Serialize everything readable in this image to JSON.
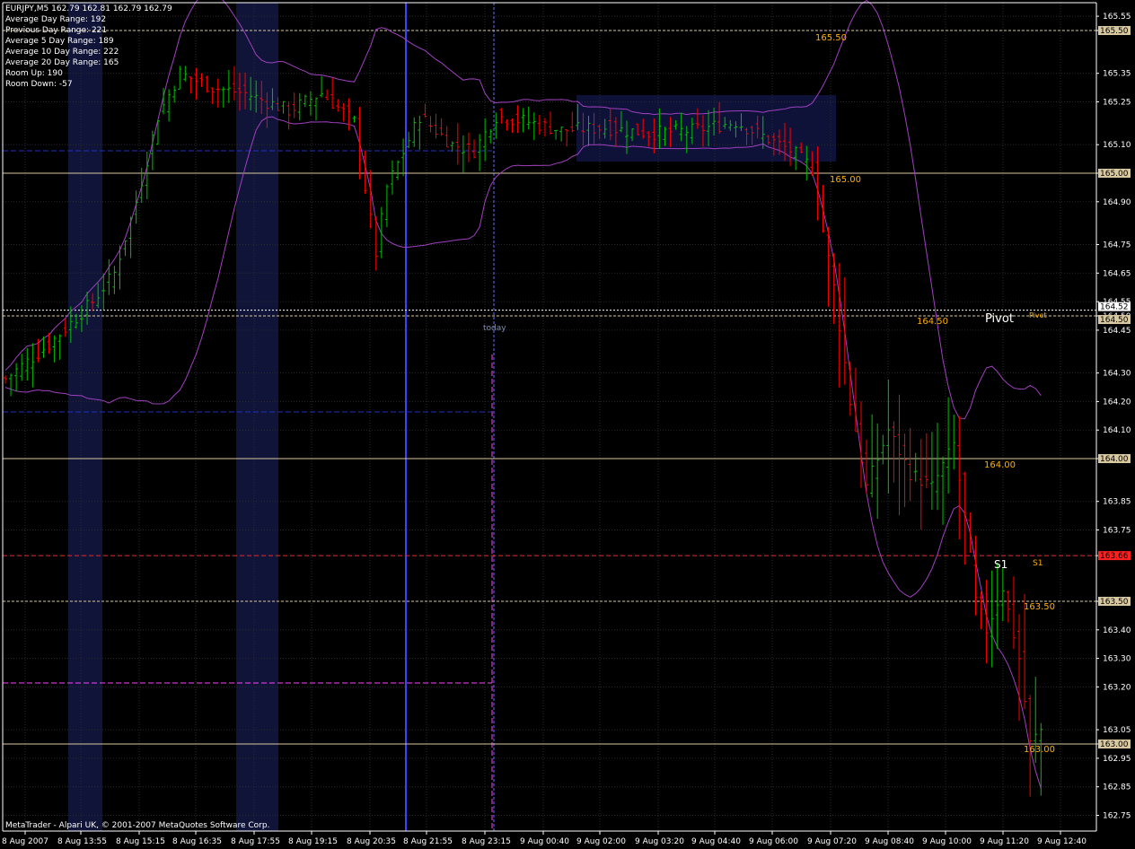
{
  "symbol_header": "EURJPY,M5  162.79 162.81 162.79 162.79",
  "info_lines": [
    "Average Day  Range: 192",
    "Previous  Day  Range: 221",
    "Average  5 Day Range: 189",
    "Average 10 Day Range: 222",
    "Average 20 Day Range: 165",
    "Room Up:     190",
    "Room Down: -57"
  ],
  "copyright": "MetaTrader - Alpari UK, © 2001-2007 MetaQuotes Software Corp.",
  "today_label": "today",
  "colors": {
    "background": "#000000",
    "grid": "#2b2b2b",
    "up_bar": "#00c000",
    "down_bar": "#ff0000",
    "bollinger": "#a040c0",
    "session_band": "#101438",
    "level_line": "#d8c8a0",
    "level_label": "#ffb000",
    "pivot_line": "#ffffff",
    "s1_line": "#ff2020",
    "today_line": "#ff40ff",
    "vertical_blue": "#4040ff"
  },
  "chart_data": {
    "type": "line",
    "title": "EURJPY,M5",
    "symbol": "EURJPY",
    "timeframe": "M5",
    "ylim": [
      162.72,
      165.62
    ],
    "y_ticks": [
      "165.55",
      "165.50",
      "165.35",
      "165.25",
      "165.10",
      "165.00",
      "164.90",
      "164.75",
      "164.65",
      "164.55",
      "164.50",
      "164.45",
      "164.30",
      "164.20",
      "164.10",
      "164.00",
      "163.85",
      "163.75",
      "163.66",
      "163.50",
      "163.40",
      "163.30",
      "163.20",
      "163.05",
      "163.00",
      "162.95",
      "162.85",
      "162.75"
    ],
    "x_ticks": [
      "8 Aug 2007",
      "8 Aug 13:55",
      "8 Aug 15:15",
      "8 Aug 16:35",
      "8 Aug 17:55",
      "8 Aug 19:15",
      "8 Aug 20:35",
      "8 Aug 21:55",
      "8 Aug 23:15",
      "9 Aug 00:40",
      "9 Aug 02:00",
      "9 Aug 03:20",
      "9 Aug 04:40",
      "9 Aug 06:00",
      "9 Aug 07:20",
      "9 Aug 08:40",
      "9 Aug 10:00",
      "9 Aug 11:20",
      "9 Aug 12:40"
    ],
    "price_tags": [
      {
        "value": 165.5,
        "text": "165.50"
      },
      {
        "value": 165.0,
        "text": "165.00"
      },
      {
        "value": 164.52,
        "text": "164.52"
      },
      {
        "value": 164.5,
        "text": "164.50"
      },
      {
        "value": 164.0,
        "text": "164.00"
      },
      {
        "value": 163.66,
        "text": "163.66"
      },
      {
        "value": 163.5,
        "text": "163.50"
      },
      {
        "value": 163.0,
        "text": "163.00"
      }
    ],
    "level_labels": [
      {
        "value": 165.5,
        "text": "165.50"
      },
      {
        "value": 165.0,
        "text": "165.00"
      },
      {
        "value": 164.5,
        "text": "164.50"
      },
      {
        "value": 164.0,
        "text": "164.00"
      },
      {
        "value": 163.5,
        "text": "163.50"
      },
      {
        "value": 163.0,
        "text": "163.00"
      }
    ],
    "pivot": {
      "value": 164.52,
      "label": "Pivot",
      "label_small": "Pivot"
    },
    "s1": {
      "value": 163.66,
      "label": "S1",
      "label_small": "S1"
    },
    "close_path": [
      [
        0,
        164.28
      ],
      [
        8,
        164.4
      ],
      [
        16,
        164.55
      ],
      [
        20,
        164.65
      ],
      [
        24,
        164.9
      ],
      [
        28,
        165.2
      ],
      [
        32,
        165.35
      ],
      [
        38,
        165.3
      ],
      [
        44,
        165.28
      ],
      [
        52,
        165.22
      ],
      [
        58,
        165.28
      ],
      [
        64,
        165.18
      ],
      [
        66,
        164.95
      ],
      [
        68,
        164.72
      ],
      [
        70,
        164.95
      ],
      [
        76,
        165.2
      ],
      [
        82,
        165.1
      ],
      [
        86,
        165.08
      ],
      [
        90,
        165.2
      ],
      [
        96,
        165.18
      ],
      [
        102,
        165.15
      ],
      [
        110,
        165.16
      ],
      [
        118,
        165.14
      ],
      [
        126,
        165.15
      ],
      [
        134,
        165.18
      ],
      [
        140,
        165.12
      ],
      [
        144,
        165.08
      ],
      [
        148,
        165.02
      ],
      [
        150,
        164.8
      ],
      [
        152,
        164.6
      ],
      [
        155,
        164.2
      ],
      [
        158,
        163.9
      ],
      [
        162,
        164.1
      ],
      [
        166,
        163.95
      ],
      [
        170,
        163.9
      ],
      [
        174,
        164.05
      ],
      [
        176,
        163.8
      ],
      [
        178,
        163.5
      ],
      [
        180,
        163.4
      ],
      [
        183,
        163.55
      ],
      [
        186,
        163.3
      ],
      [
        188,
        163.0
      ],
      [
        190,
        163.05
      ]
    ],
    "n_bars": 191
  }
}
